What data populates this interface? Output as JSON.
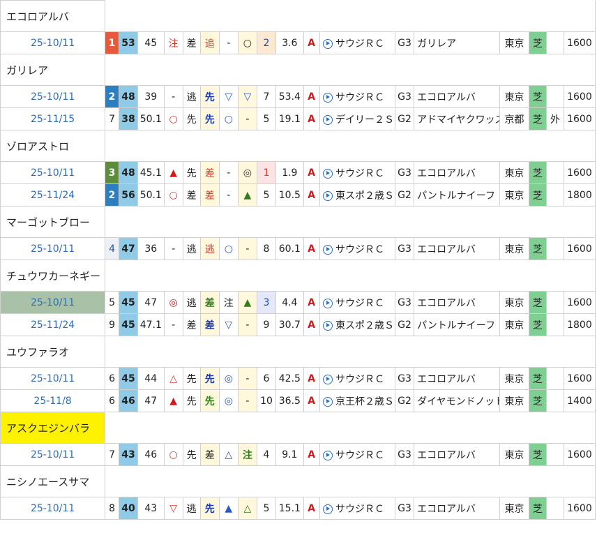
{
  "horses": [
    {
      "name": "エコロアルバ",
      "highlight": false,
      "rows": [
        {
          "date": "25-10/11",
          "date_sel": false,
          "fin": "1",
          "fin_cls": "fin1",
          "score": "53",
          "v1": "45",
          "m1": "注",
          "m1c": "red",
          "st": "差",
          "m2": "追",
          "m2c": "red cream",
          "m3": "-",
          "m3c": "",
          "m4": "○",
          "m4c": "",
          "pop": "2",
          "popc": "pop2",
          "odds": "3.6",
          "grade_mark": "A",
          "race": "サウジＲＣ",
          "grade": "G3",
          "winner": "ガリレア",
          "place": "東京",
          "surface": "芝",
          "extra": "",
          "dist": "1600"
        }
      ]
    },
    {
      "name": "ガリレア",
      "highlight": false,
      "rows": [
        {
          "date": "25-10/11",
          "date_sel": false,
          "fin": "2",
          "fin_cls": "fin2",
          "score": "48",
          "v1": "39",
          "m1": "-",
          "m1c": "",
          "st": "逃",
          "m2": "先",
          "m2c": "blue cream",
          "m3": "▽",
          "m3c": "circ-open",
          "m4": "▽",
          "m4c": "circ-open",
          "pop": "7",
          "popc": "",
          "odds": "53.4",
          "grade_mark": "A",
          "race": "サウジＲＣ",
          "grade": "G3",
          "winner": "エコロアルバ",
          "place": "東京",
          "surface": "芝",
          "extra": "",
          "dist": "1600"
        },
        {
          "date": "25-11/15",
          "date_sel": false,
          "fin": "7",
          "fin_cls": "",
          "score": "38",
          "v1": "50.1",
          "m1": "○",
          "m1c": "red",
          "st": "先",
          "m2": "先",
          "m2c": "blue cream",
          "m3": "○",
          "m3c": "circ-open",
          "m4": "-",
          "m4c": "",
          "pop": "5",
          "popc": "",
          "odds": "19.1",
          "grade_mark": "A",
          "race": "デイリー２Ｓ",
          "grade": "G2",
          "winner": "アドマイヤクワッズ",
          "place": "京都",
          "surface": "芝",
          "extra": "外",
          "dist": "1600"
        }
      ]
    },
    {
      "name": "ゾロアストロ",
      "highlight": false,
      "rows": [
        {
          "date": "25-10/11",
          "date_sel": false,
          "fin": "3",
          "fin_cls": "fin3",
          "score": "48",
          "v1": "45.1",
          "m1": "▲",
          "m1c": "tri-up-red",
          "st": "先",
          "m2": "差",
          "m2c": "red cream",
          "m3": "-",
          "m3c": "",
          "m4": "◎",
          "m4c": "sym-o",
          "pop": "1",
          "popc": "pop1",
          "odds": "1.9",
          "grade_mark": "A",
          "race": "サウジＲＣ",
          "grade": "G3",
          "winner": "エコロアルバ",
          "place": "東京",
          "surface": "芝",
          "extra": "",
          "dist": "1600"
        },
        {
          "date": "25-11/24",
          "date_sel": false,
          "fin": "2",
          "fin_cls": "fin2",
          "score": "56",
          "v1": "50.1",
          "m1": "○",
          "m1c": "red",
          "st": "差",
          "m2": "差",
          "m2c": "red cream",
          "m3": "-",
          "m3c": "",
          "m4": "▲",
          "m4c": "tri-up-green",
          "pop": "5",
          "popc": "",
          "odds": "10.5",
          "grade_mark": "A",
          "race": "東スポ２歳Ｓ",
          "grade": "G2",
          "winner": "パントルナイーフ",
          "place": "東京",
          "surface": "芝",
          "extra": "",
          "dist": "1800"
        }
      ]
    },
    {
      "name": "マーゴットブロー",
      "highlight": false,
      "rows": [
        {
          "date": "25-10/11",
          "date_sel": false,
          "fin": "4",
          "fin_cls": "fin4",
          "score": "47",
          "v1": "36",
          "m1": "-",
          "m1c": "",
          "st": "逃",
          "m2": "逃",
          "m2c": "red cream",
          "m3": "○",
          "m3c": "circ-open",
          "m4": "-",
          "m4c": "",
          "pop": "8",
          "popc": "",
          "odds": "60.1",
          "grade_mark": "A",
          "race": "サウジＲＣ",
          "grade": "G3",
          "winner": "エコロアルバ",
          "place": "東京",
          "surface": "芝",
          "extra": "",
          "dist": "1600"
        }
      ]
    },
    {
      "name": "チュウワカーネギー",
      "highlight": false,
      "rows": [
        {
          "date": "25-10/11",
          "date_sel": true,
          "fin": "5",
          "fin_cls": "",
          "score": "45",
          "v1": "47",
          "m1": "◎",
          "m1c": "dblcirc-red",
          "st": "逃",
          "m2": "差",
          "m2c": "green cream",
          "m3": "注",
          "m3c": "blue-text",
          "m4": "▲",
          "m4c": "tri-up-green",
          "pop": "3",
          "popc": "pop3",
          "odds": "4.4",
          "grade_mark": "A",
          "race": "サウジＲＣ",
          "grade": "G3",
          "winner": "エコロアルバ",
          "place": "東京",
          "surface": "芝",
          "extra": "",
          "dist": "1600"
        },
        {
          "date": "25-11/24",
          "date_sel": false,
          "fin": "9",
          "fin_cls": "",
          "score": "45",
          "v1": "47.1",
          "m1": "-",
          "m1c": "",
          "st": "差",
          "m2": "差",
          "m2c": "blue cream",
          "m3": "▽",
          "m3c": "circ-open",
          "m4": "-",
          "m4c": "",
          "pop": "9",
          "popc": "",
          "odds": "30.7",
          "grade_mark": "A",
          "race": "東スポ２歳Ｓ",
          "grade": "G2",
          "winner": "パントルナイーフ",
          "place": "東京",
          "surface": "芝",
          "extra": "",
          "dist": "1800"
        }
      ]
    },
    {
      "name": "ユウファラオ",
      "highlight": false,
      "rows": [
        {
          "date": "25-10/11",
          "date_sel": false,
          "fin": "6",
          "fin_cls": "",
          "score": "45",
          "v1": "44",
          "m1": "△",
          "m1c": "red",
          "st": "先",
          "m2": "先",
          "m2c": "blue cream",
          "m3": "◎",
          "m3c": "dblcirc-blue",
          "m4": "-",
          "m4c": "",
          "pop": "6",
          "popc": "",
          "odds": "42.5",
          "grade_mark": "A",
          "race": "サウジＲＣ",
          "grade": "G3",
          "winner": "エコロアルバ",
          "place": "東京",
          "surface": "芝",
          "extra": "",
          "dist": "1600"
        },
        {
          "date": "25-11/8",
          "date_sel": false,
          "fin": "6",
          "fin_cls": "",
          "score": "46",
          "v1": "47",
          "m1": "▲",
          "m1c": "tri-up-red",
          "st": "先",
          "m2": "先",
          "m2c": "green cream",
          "m3": "◎",
          "m3c": "dblcirc-blue",
          "m4": "-",
          "m4c": "",
          "pop": "10",
          "popc": "",
          "odds": "36.5",
          "grade_mark": "A",
          "race": "京王杯２歳Ｓ",
          "grade": "G2",
          "winner": "ダイヤモンドノット",
          "place": "東京",
          "surface": "芝",
          "extra": "",
          "dist": "1400"
        }
      ]
    },
    {
      "name": "アスクエジンバラ",
      "highlight": true,
      "rows": [
        {
          "date": "25-10/11",
          "date_sel": false,
          "fin": "7",
          "fin_cls": "",
          "score": "43",
          "v1": "46",
          "m1": "○",
          "m1c": "red",
          "st": "先",
          "m2": "差",
          "m2c": "cream",
          "m3": "△",
          "m3c": "circ-open",
          "m4": "注",
          "m4c": "green",
          "pop": "4",
          "popc": "",
          "odds": "9.1",
          "grade_mark": "A",
          "race": "サウジＲＣ",
          "grade": "G3",
          "winner": "エコロアルバ",
          "place": "東京",
          "surface": "芝",
          "extra": "",
          "dist": "1600"
        }
      ]
    },
    {
      "name": "ニシノエースサマ",
      "highlight": false,
      "rows": [
        {
          "date": "25-10/11",
          "date_sel": false,
          "fin": "8",
          "fin_cls": "",
          "score": "40",
          "v1": "43",
          "m1": "▽",
          "m1c": "red",
          "st": "逃",
          "m2": "先",
          "m2c": "blue cream",
          "m3": "▲",
          "m3c": "tri-up-blue",
          "m4": "△",
          "m4c": "tri-up-green",
          "pop": "5",
          "popc": "",
          "odds": "15.1",
          "grade_mark": "A",
          "race": "サウジＲＣ",
          "grade": "G3",
          "winner": "エコロアルバ",
          "place": "東京",
          "surface": "芝",
          "extra": "",
          "dist": "1600"
        }
      ]
    }
  ]
}
